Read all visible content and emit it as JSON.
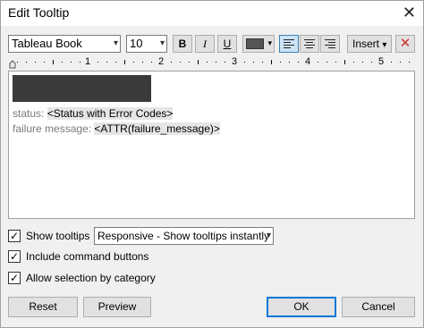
{
  "window": {
    "title": "Edit Tooltip",
    "close_glyph": "✕"
  },
  "toolbar": {
    "font_family": "Tableau Book",
    "font_size": "10",
    "bold_label": "B",
    "italic_label": "I",
    "underline_label": "U",
    "text_color": "#555555",
    "insert_label": "Insert",
    "clear_glyph": "✕",
    "dropdown_glyph": "▾"
  },
  "ruler": {
    "marks": [
      "1",
      "2",
      "3",
      "4",
      "5"
    ]
  },
  "editor": {
    "lines": [
      {
        "label": "status:",
        "field": "<Status with Error Codes>"
      },
      {
        "label": "failure message:",
        "field": "<ATTR(failure_message)>"
      }
    ]
  },
  "options": {
    "show_tooltips": {
      "label": "Show tooltips",
      "checked": true
    },
    "tooltip_mode": "Responsive - Show tooltips instantly",
    "include_command_buttons": {
      "label": "Include command buttons",
      "checked": true
    },
    "allow_selection": {
      "label": "Allow selection by category",
      "checked": true
    },
    "check_glyph": "✓"
  },
  "buttons": {
    "reset": "Reset",
    "preview": "Preview",
    "ok": "OK",
    "cancel": "Cancel"
  }
}
